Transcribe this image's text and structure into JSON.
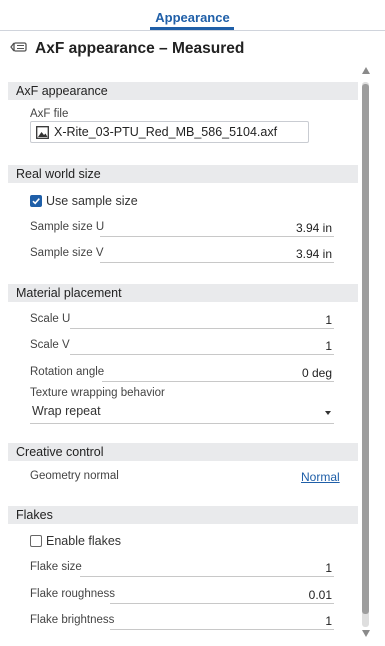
{
  "tab": {
    "label": "Appearance"
  },
  "panel": {
    "title": "AxF appearance – Measured",
    "icon": "appearance-tag-icon"
  },
  "sections": {
    "axf": {
      "header": "AxF appearance",
      "file_label": "AxF file",
      "file_name": "X-Rite_03-PTU_Red_MB_586_5104.axf"
    },
    "real_world": {
      "header": "Real world size",
      "use_sample_label": "Use sample size",
      "use_sample_checked": true,
      "size_u_label": "Sample size U",
      "size_u_value": "3.94 in",
      "size_v_label": "Sample size V",
      "size_v_value": "3.94 in"
    },
    "placement": {
      "header": "Material placement",
      "scale_u_label": "Scale U",
      "scale_u_value": "1",
      "scale_v_label": "Scale V",
      "scale_v_value": "1",
      "rotation_label": "Rotation angle",
      "rotation_value": "0 deg",
      "wrap_label": "Texture wrapping behavior",
      "wrap_value": "Wrap repeat"
    },
    "creative": {
      "header": "Creative control",
      "geometry_normal_label": "Geometry normal",
      "geometry_normal_value": "Normal"
    },
    "flakes": {
      "header": "Flakes",
      "enable_label": "Enable flakes",
      "enable_checked": false,
      "size_label": "Flake size",
      "size_value": "1",
      "roughness_label": "Flake roughness",
      "roughness_value": "0.01",
      "brightness_label": "Flake brightness",
      "brightness_value": "1"
    }
  },
  "colors": {
    "accent": "#1f5fa8",
    "section_bg": "#e9eaec"
  }
}
